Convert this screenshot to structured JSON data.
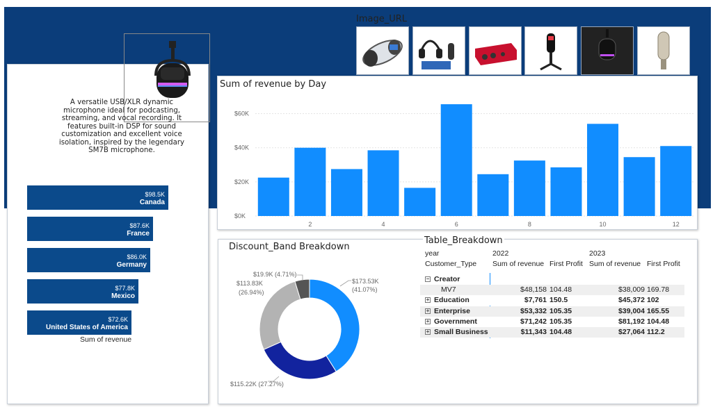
{
  "image_url": {
    "title": "Image_URL",
    "thumbnails": [
      {
        "icon": "white-headset-icon",
        "dark": false
      },
      {
        "icon": "headphones-mic-kit-icon",
        "dark": false
      },
      {
        "icon": "audio-interface-icon",
        "dark": false
      },
      {
        "icon": "condenser-mic-stand-icon",
        "dark": false
      },
      {
        "icon": "dynamic-mic-icon",
        "dark": true
      },
      {
        "icon": "studio-condenser-mic-icon",
        "dark": false
      }
    ]
  },
  "product": {
    "icon": "dynamic-microphone-icon",
    "description": "A versatile USB/XLR dynamic microphone ideal for podcasting, streaming, and vocal recording. It features built-in DSP for sound customization and excellent voice isolation, inspired by the legendary SM7B microphone."
  },
  "country_chart": {
    "axis_label": "Sum of revenue",
    "bars": [
      {
        "country": "Canada",
        "label": "$98.5K",
        "value": 98.5
      },
      {
        "country": "France",
        "label": "$87.6K",
        "value": 87.6
      },
      {
        "country": "Germany",
        "label": "$86.0K",
        "value": 86.0
      },
      {
        "country": "Mexico",
        "label": "$77.8K",
        "value": 77.8
      },
      {
        "country": "United States of America",
        "label": "$72.6K",
        "value": 72.6
      }
    ]
  },
  "chart_data": [
    {
      "type": "bar",
      "title": "Sum of revenue by Day",
      "categories": [
        1,
        2,
        3,
        4,
        5,
        6,
        7,
        8,
        9,
        10,
        11,
        12
      ],
      "values": [
        22500,
        40000,
        27500,
        38500,
        16500,
        65500,
        24500,
        32500,
        28500,
        54000,
        34500,
        41000
      ],
      "ylim": [
        0,
        70000
      ],
      "yticks": [
        "$0K",
        "$20K",
        "$40K",
        "$60K"
      ],
      "xticks": [
        "2",
        "4",
        "6",
        "8",
        "10",
        "12"
      ],
      "grid": true,
      "color": "#118dff"
    },
    {
      "type": "pie",
      "title": "Discount_Band Breakdown",
      "slices": [
        {
          "label": "$173.53K",
          "pct": "(41.07%)",
          "value": 173.53,
          "color": "#118dff"
        },
        {
          "label": "$115.22K (27.27%)",
          "value": 115.22,
          "color": "#12239e"
        },
        {
          "label": "$113.83K",
          "pct": "(26.94%)",
          "value": 113.83,
          "color": "#b3b3b3"
        },
        {
          "label": "$19.9K (4.71%)",
          "value": 19.9,
          "color": "#555555"
        }
      ]
    }
  ],
  "table": {
    "title": "Table_Breakdown",
    "year_label": "year",
    "row_header": "Customer_Type",
    "years": [
      "2022",
      "2023"
    ],
    "col_headers": [
      "Sum of revenue",
      "First Profit",
      "Sum of revenue",
      "First Profit"
    ],
    "rows": [
      {
        "label": "Creator",
        "toggle": "⊟",
        "bold": true,
        "cells": [
          "",
          "",
          "",
          ""
        ]
      },
      {
        "label": "MV7",
        "toggle": "",
        "bold": false,
        "indent": true,
        "cells": [
          "$48,158",
          "104.48",
          "$38,009",
          "169.78"
        ]
      },
      {
        "label": "Education",
        "toggle": "+",
        "bold": true,
        "cells": [
          "$7,761",
          "150.5",
          "$45,372",
          "102"
        ]
      },
      {
        "label": "Enterprise",
        "toggle": "+",
        "bold": true,
        "cells": [
          "$53,332",
          "105.35",
          "$39,004",
          "165.55"
        ]
      },
      {
        "label": "Government",
        "toggle": "+",
        "bold": true,
        "cells": [
          "$71,242",
          "105.35",
          "$81,192",
          "104.48"
        ]
      },
      {
        "label": "Small Business",
        "toggle": "+",
        "bold": true,
        "cells": [
          "$11,343",
          "104.48",
          "$27,064",
          "112.2"
        ]
      }
    ]
  }
}
